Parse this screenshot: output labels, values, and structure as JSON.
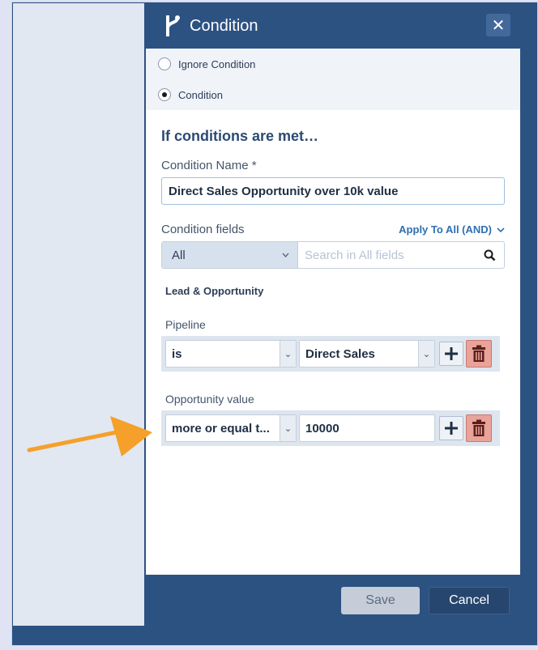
{
  "dialog": {
    "title": "Condition",
    "close_symbol": "✕",
    "icon": "branch-icon"
  },
  "radio_options": [
    {
      "label": "Ignore Condition",
      "selected": false
    },
    {
      "label": "Condition",
      "selected": true
    }
  ],
  "form": {
    "section_title": "If conditions are met…",
    "condition_name_label": "Condition Name *",
    "condition_name_value": "Direct Sales Opportunity over 10k value",
    "condition_fields_label": "Condition fields",
    "apply_label": "Apply To All (AND)",
    "filter_select_value": "All",
    "search_placeholder": "Search in All fields",
    "group_title": "Lead & Opportunity"
  },
  "conditions": [
    {
      "label": "Pipeline",
      "operator": "is",
      "value": "Direct Sales",
      "value_is_dropdown": true
    },
    {
      "label": "Opportunity value",
      "operator": "more or equal t...",
      "value": "10000",
      "value_is_dropdown": false
    }
  ],
  "footer": {
    "save_label": "Save",
    "cancel_label": "Cancel"
  },
  "colors": {
    "header_bg": "#2c5282",
    "delete_button": "#e9a39a",
    "arrow": "#f5a02b",
    "link": "#2f6fb0"
  }
}
